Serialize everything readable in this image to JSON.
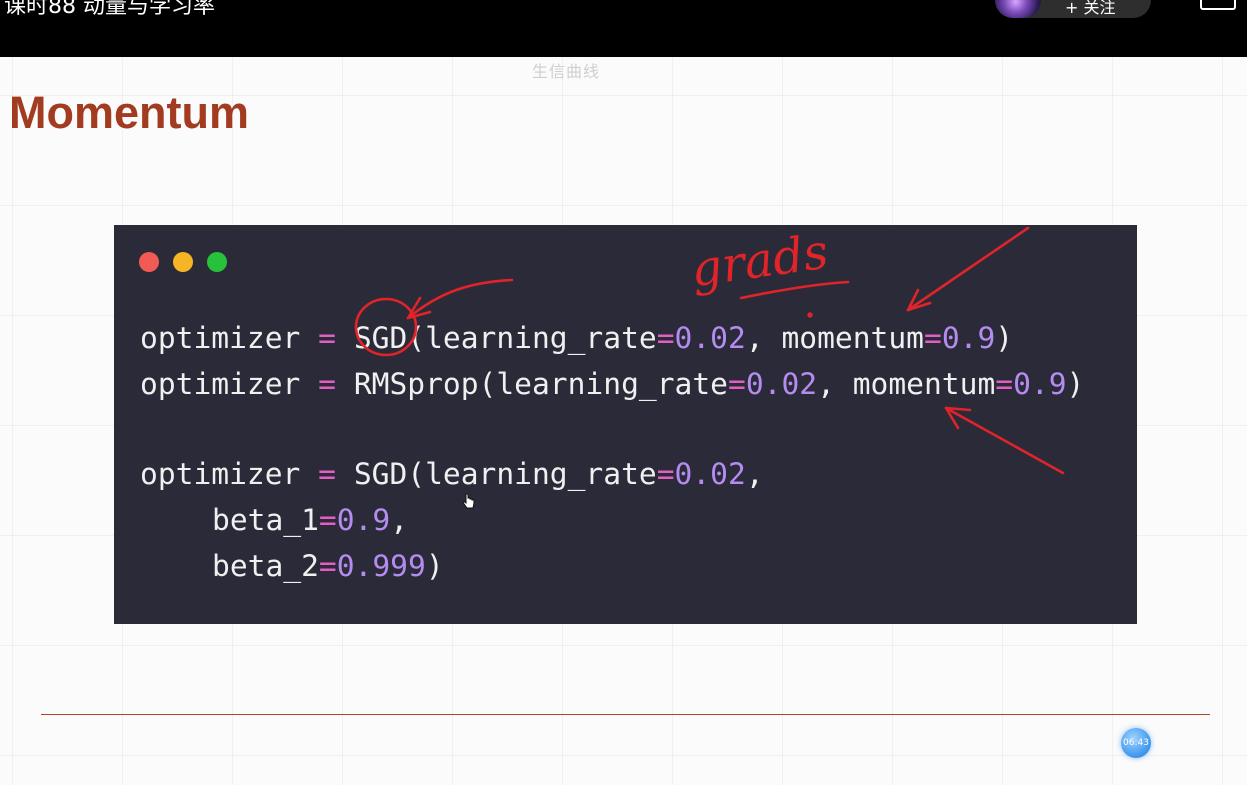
{
  "video": {
    "title": "课时88 动量与学习率",
    "follow_label": "+ 关注"
  },
  "slide": {
    "watermark": "生信曲线",
    "title": "Momentum"
  },
  "code_lines": [
    [
      [
        "optimizer ",
        ""
      ],
      [
        "=",
        "op"
      ],
      [
        " SGD(learning_rate",
        ""
      ],
      [
        "=",
        "op"
      ],
      [
        "0.02",
        "num"
      ],
      [
        ", momentum",
        ""
      ],
      [
        "=",
        "op"
      ],
      [
        "0.9",
        "num"
      ],
      [
        ")",
        ""
      ]
    ],
    [
      [
        "optimizer ",
        ""
      ],
      [
        "=",
        "op"
      ],
      [
        " RMSprop(learning_rate",
        ""
      ],
      [
        "=",
        "op"
      ],
      [
        "0.02",
        "num"
      ],
      [
        ", momentum",
        ""
      ],
      [
        "=",
        "op"
      ],
      [
        "0.9",
        "num"
      ],
      [
        ")",
        ""
      ]
    ],
    [],
    [
      [
        "optimizer ",
        ""
      ],
      [
        "=",
        "op"
      ],
      [
        " SGD(learning_rate",
        ""
      ],
      [
        "=",
        "op"
      ],
      [
        "0.02",
        "num"
      ],
      [
        ",",
        ""
      ]
    ],
    [
      [
        "beta_1",
        ""
      ],
      [
        "=",
        "op"
      ],
      [
        "0.9",
        "num"
      ],
      [
        ",",
        ""
      ]
    ],
    [
      [
        "beta_2",
        ""
      ],
      [
        "=",
        "op"
      ],
      [
        "0.999",
        "num"
      ],
      [
        ")",
        ""
      ]
    ]
  ],
  "annotation": {
    "handwriting": "grads",
    "ink_color": "#e0242a"
  },
  "timestamp": "06:43",
  "colors": {
    "title": "#a23b1f",
    "code_bg": "#2a2a38",
    "operator": "#e15fc2",
    "number": "#b48cf0",
    "rule": "#b34428"
  }
}
